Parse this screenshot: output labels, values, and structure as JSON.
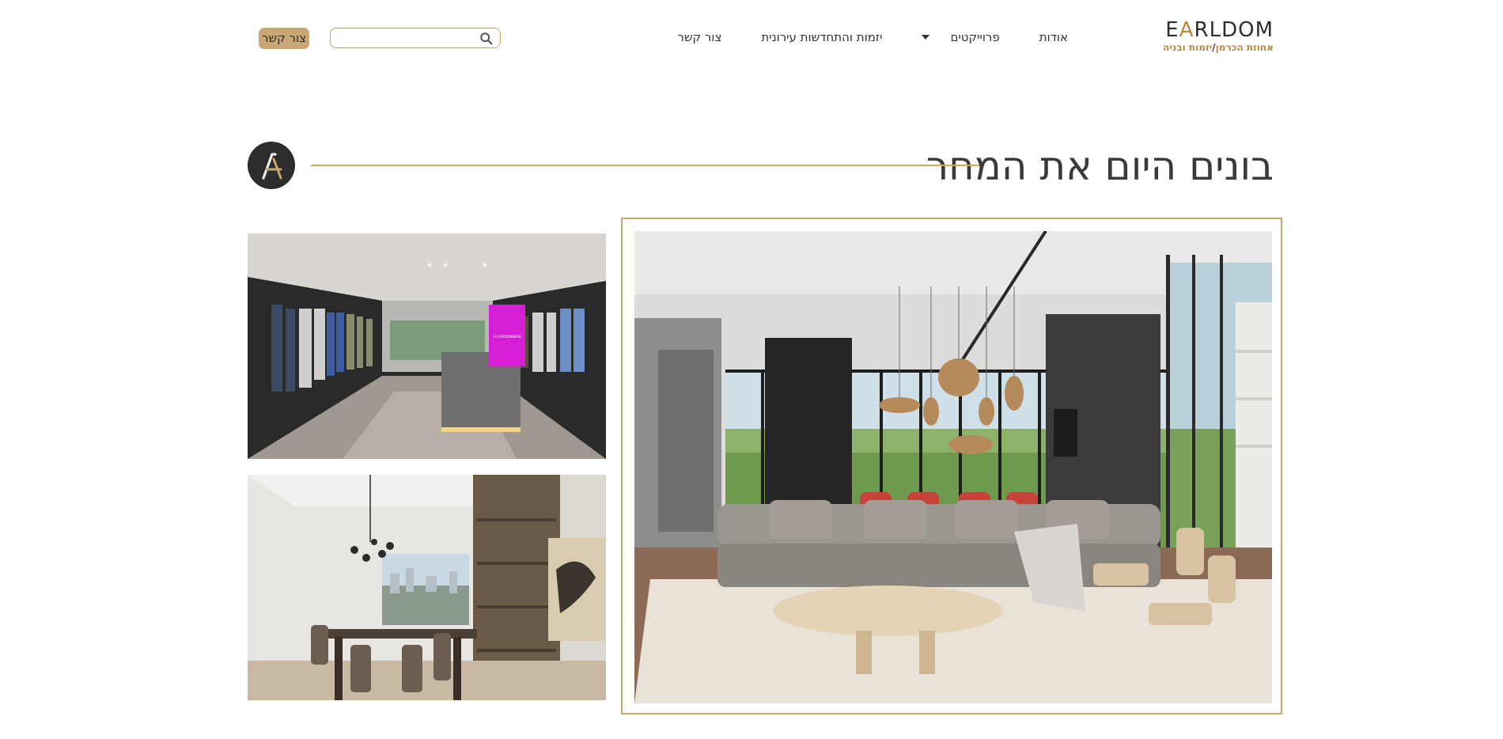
{
  "header": {
    "logo": {
      "word_prefix": "E",
      "word_accent": "A",
      "word_suffix": "RLDOM",
      "sub_left": "אחוזת הכרמן",
      "sub_sep": "/",
      "sub_right": "יזמות ובניה"
    },
    "nav": [
      {
        "label": "אודות",
        "has_dropdown": false
      },
      {
        "label": "פרוייקטים",
        "has_dropdown": true
      },
      {
        "label": "יזמות והתחדשות עירונית",
        "has_dropdown": false
      },
      {
        "label": "צור קשר",
        "has_dropdown": false
      }
    ],
    "search": {
      "value": "",
      "placeholder": "",
      "icon": "search-icon"
    },
    "contact_button": "צור קשר"
  },
  "hero": {
    "title": "בונים היום את המחר",
    "badge_icon": "brand-monogram-icon"
  },
  "colors": {
    "gold": "#c9a86a",
    "dark": "#2d2d2d",
    "button_bg": "#c9a775"
  },
  "images": {
    "main": "living-room-render",
    "top_left": "clothing-store-render",
    "bottom_left": "dining-room-render",
    "store_screen_text": "LA CARDONNIERE"
  }
}
